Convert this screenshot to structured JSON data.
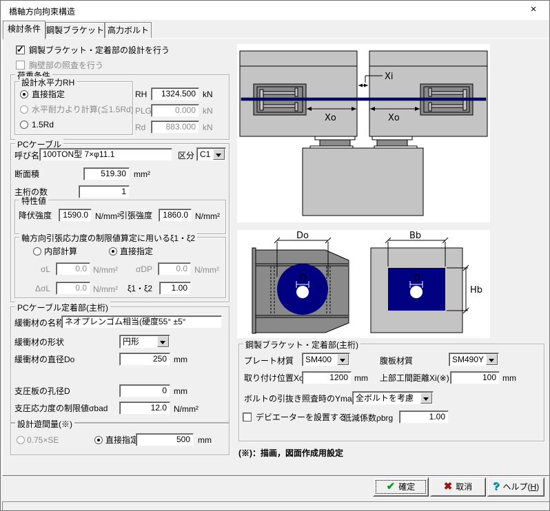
{
  "window": {
    "title": "橋軸方向拘束構造",
    "close_glyph": "×"
  },
  "tabs": {
    "t1": "検討条件",
    "t2": "鋼製ブラケット",
    "t3": "高力ボルト"
  },
  "glyphs": {
    "check": "✓"
  },
  "top": {
    "cb1": "鋼製ブラケット・定着部の設計を行う",
    "cb2": "胸壁部の照査を行う"
  },
  "load": {
    "g": "荷重条件",
    "sub": "設計水平力RH",
    "r1": "直接指定",
    "r2": "水平耐力より計算(≦1.5Rd)",
    "r3": "1.5Rd",
    "rh_l": "RH",
    "rh_v": "1324.500",
    "plg_l": "PLG",
    "plg_v": "0.000",
    "rd_l": "Rd",
    "rd_v": "883.000",
    "kn": "kN"
  },
  "pc": {
    "g": "PCケーブル",
    "name_l": "呼び名",
    "name_v": "100TON型 7×φ11.1",
    "kubun_l": "区分",
    "kubun_v": "C1",
    "area_l": "断面積",
    "area_v": "519.30",
    "area_u": "mm²",
    "num_l": "主桁の数",
    "num_v": "1"
  },
  "prop": {
    "g": "特性値",
    "yield_l": "降伏強度",
    "yield_v": "1590.0",
    "tens_l": "引張強度",
    "tens_v": "1860.0",
    "u": "N/mm²"
  },
  "xi2": {
    "g": "軸方向引張応力度の制限値算定に用いるξ1・ξ2",
    "r1": "内部計算",
    "r2": "直接指定",
    "sl_l": "σL",
    "sl_v": "0.0",
    "sdp_l": "σDP",
    "sdp_v": "0.0",
    "dsl_l": "ΔσL",
    "dsl_v": "0.0",
    "xi_l": "ξ1・ξ2",
    "xi_v": "1.00",
    "u": "N/mm²"
  },
  "anch": {
    "g": "PCケーブル定着部(主桁)",
    "n_l": "緩衝材の名称",
    "n_v": "ネオプレンゴム相当(硬度55° ±5°",
    "s_l": "緩衝材の形状",
    "s_v": "円形",
    "d_l": "緩衝材の直径Do",
    "d_v": "250",
    "hole_l": "支圧板の孔径D",
    "hole_v": "0",
    "sig_l": "支圧応力度の制限値σbad",
    "sig_v": "12.0",
    "mm": "mm",
    "u": "N/mm²"
  },
  "gap": {
    "g": "設計遊間量(※)",
    "r1": "0.75×SE",
    "r2": "直接指定",
    "v": "500",
    "mm": "mm"
  },
  "brk": {
    "g": "鋼製ブラケット・定着部(主桁)",
    "plate_l": "プレート材質",
    "plate_v": "SM400",
    "web_l": "腹板材質",
    "web_v": "SM490Y",
    "xo_l": "取り付け位置Xo",
    "xo_v": "1200",
    "xi_l": "上部工間距離Xi(※)",
    "xi_v": "100",
    "ymax_l": "ボルトの引抜き照査時のYmax",
    "ymax_v": "全ボルトを考慮",
    "dev_l": "デビエーターを設置する",
    "rho_l": "低減係数ρbrg",
    "rho_v": "1.00",
    "mm": "mm"
  },
  "note": "(※)：描画，図面作成用設定",
  "btns": {
    "ok": "確定",
    "cancel": "取消",
    "help_pre": "ヘルプ(",
    "help_key": "H",
    "help_suf": ")",
    "ok_icon": "✔",
    "cancel_icon": "✖",
    "help_icon": "?"
  },
  "diagram": {
    "xi": "Xi",
    "xo": "Xo",
    "do_l": "Do",
    "bb": "Bb",
    "d": "D",
    "hb": "Hb",
    "colors": {
      "cable": "#000080",
      "girder": "#c4c4c4",
      "bracket": "#8a8a8a"
    }
  }
}
